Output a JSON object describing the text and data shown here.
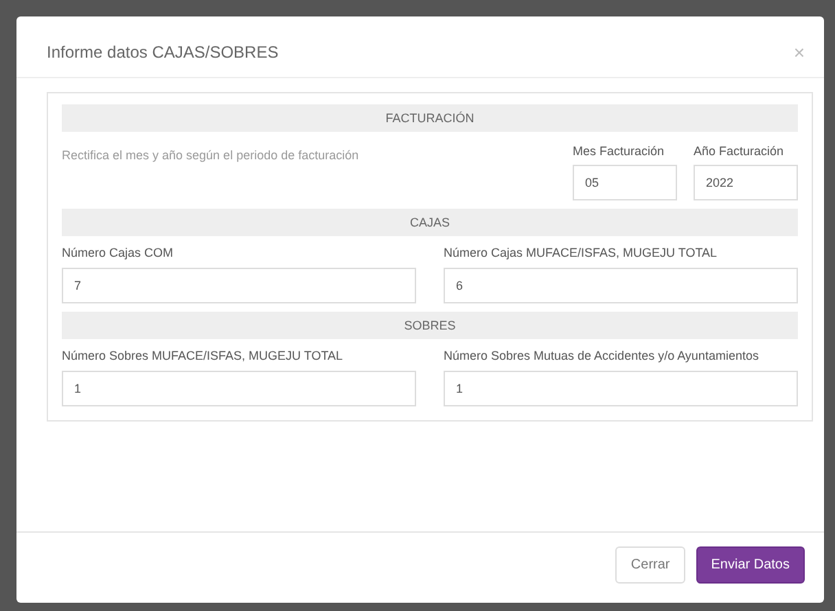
{
  "modal": {
    "title": "Informe datos CAJAS/SOBRES",
    "close": "×"
  },
  "facturacion": {
    "heading": "FACTURACIÓN",
    "note": "Rectifica el mes y año según el periodo de facturación",
    "fields": [
      {
        "label": "Mes Facturación",
        "value": "05"
      },
      {
        "label": "Año Facturación",
        "value": "2022"
      }
    ]
  },
  "sections": [
    {
      "heading": "CAJAS",
      "fields": [
        {
          "label": "Número Cajas COM",
          "value": "7"
        },
        {
          "label": "Número Cajas MUFACE/ISFAS, MUGEJU TOTAL",
          "value": "6"
        }
      ]
    },
    {
      "heading": "SOBRES",
      "fields": [
        {
          "label": "Número Sobres MUFACE/ISFAS, MUGEJU TOTAL",
          "value": "1"
        },
        {
          "label": "Número Sobres Mutuas de Accidentes y/o Ayuntamientos",
          "value": "1"
        }
      ]
    }
  ],
  "buttons": [
    {
      "label": "Cerrar",
      "kind": "secondary"
    },
    {
      "label": "Enviar Datos",
      "kind": "primary"
    }
  ]
}
